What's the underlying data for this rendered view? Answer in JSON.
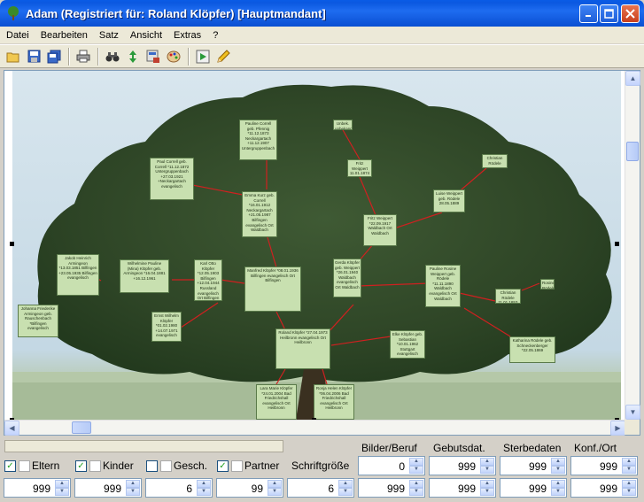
{
  "window": {
    "title": "Adam (Registriert für: Roland Klöpfer) [Hauptmandant]"
  },
  "menu": [
    "Datei",
    "Bearbeiten",
    "Satz",
    "Ansicht",
    "Extras",
    "?"
  ],
  "toolbar": {
    "icons": [
      "open-folder-icon",
      "save-icon",
      "save-all-icon",
      "print-icon",
      "binoculars-icon",
      "updown-arrows-icon",
      "tree-chart-icon",
      "palette-icon",
      "play-icon",
      "pencil-icon"
    ]
  },
  "tree": {
    "nodes": [
      {
        "id": "pauline",
        "text": "Pauline Correll geb. Pfennig *11.12.1873 Neckargartach +11.12.1907 Untergruppenbach"
      },
      {
        "id": "paul",
        "text": "Paul Correll geb. Correll *11.12.1872 Untergruppenbach +27.03.1921 +Neckargartach evangelisch"
      },
      {
        "id": "emma",
        "text": "Emma Kurz geb. Correll *16.01.1912 Neckargartach +21.05.1987 Bilfingen evangelisch Ort Waldbach"
      },
      {
        "id": "unbekannt",
        "text": "Unbek. unbekannt"
      },
      {
        "id": "fritzw",
        "text": "Fritz Weippert 11.01.1874"
      },
      {
        "id": "christianR",
        "text": "Christian Rödele"
      },
      {
        "id": "luise",
        "text": "Luise Weippert geb. Rödele 28.05.1889"
      },
      {
        "id": "fritz",
        "text": "Fritz Weippert *22.09.1917 Waldbach Ort Waldbach"
      },
      {
        "id": "jakob",
        "text": "Jakob Heinrich Armingeon *13.03.1851 Bilfingen +23.05.1935 Bilfingen evangelisch"
      },
      {
        "id": "wilhelmine",
        "text": "Wilhelmine Pauline (Mina) Klöpfer geb. Armingeon *16.04.1881 +16.12.1961"
      },
      {
        "id": "karl",
        "text": "Karl Otto Klöpfer *12.05.1903 Bilfingen +12.04.1944 Russland evangelisch Ort Bilfingen"
      },
      {
        "id": "manfred",
        "text": "Manfred Klöpfer *08.01.1936 Bilfingen evangelisch Ort Bilfingen"
      },
      {
        "id": "gerda",
        "text": "Gerda Klöpfer geb. Weippert *26.01.1940 Waldbach evangelisch Ort Waldbach"
      },
      {
        "id": "paulineR",
        "text": "Pauline Rosine Weippert geb. Rödele *11.11.1890 Waldbach evangelisch Ort Waldbach"
      },
      {
        "id": "christianR2",
        "text": "Christian Rödele *1.01.1853"
      },
      {
        "id": "rosine",
        "text": "Rosine Rödele"
      },
      {
        "id": "johanna",
        "text": "Johanna Friederike Armingeon geb. Rauschenbach *Bilfingen evangelisch"
      },
      {
        "id": "ernst",
        "text": "Ernst Wilhelm Klöpfer *01.02.1980 +14.07.1971 evangelisch"
      },
      {
        "id": "roland",
        "text": "Roland Klöpfer *27.04.1973 Heilbronn evangelisch Ort Heilbronn"
      },
      {
        "id": "elke",
        "text": "Elke Klöpfer geb. Sebastian *10.01.1962 Stuttgart evangelisch"
      },
      {
        "id": "katharina",
        "text": "Katharina Rödele geb. Schneckenberger *22.05.1869"
      },
      {
        "id": "lara",
        "text": "Lara Marie Klöpfer *24.01.2004 Bad Friedrichshall evangelisch Ort Heilbronn"
      },
      {
        "id": "ronja",
        "text": "Ronja Helen Klöpfer *06.04.2006 Bad Friedrichshall evangelisch Ort Heilbronn"
      }
    ]
  },
  "settings": {
    "headers": {
      "bilder": "Bilder/Beruf",
      "geburt": "Gebutsdat.",
      "sterbe": "Sterbedaten",
      "konf": "Konf./Ort"
    },
    "checks": {
      "eltern": "Eltern",
      "kinder": "Kinder",
      "gesch": "Gesch.",
      "partner": "Partner"
    },
    "schriftgroesse_label": "Schriftgröße",
    "row1": {
      "bilder": "0",
      "geburt": "999",
      "sterbe": "999",
      "konf": "999"
    },
    "row2": {
      "eltern": "999",
      "kinder": "999",
      "gesch": "6",
      "partner": "99",
      "schrift": "6",
      "bilder": "999",
      "geburt": "999",
      "sterbe": "999",
      "konf": "999"
    }
  }
}
